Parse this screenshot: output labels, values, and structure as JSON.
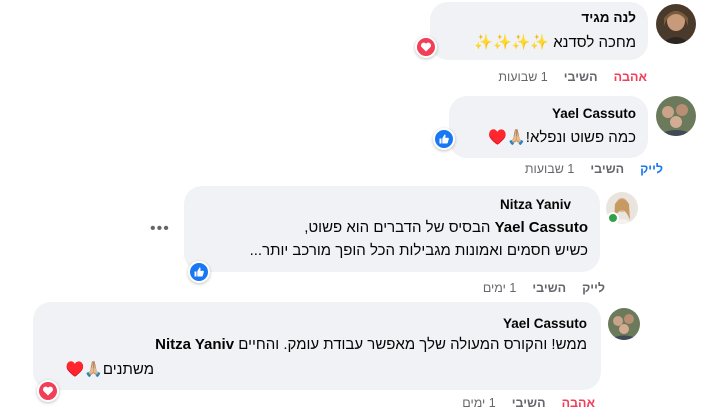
{
  "comments": [
    {
      "author": "לנה מגיד",
      "line1": "מחכה לסדנא ✨✨✨✨",
      "reaction_icon": "heart-reaction-icon",
      "actions": {
        "love": "אהבה",
        "reply": "השיבי",
        "time": "1 שבועות"
      }
    },
    {
      "author": "Yael Cassuto",
      "line1": "כמה פשוט ונפלא!🙏🏼♥️",
      "reaction_icon": "like-reaction-icon",
      "actions": {
        "like": "לייק",
        "reply": "השיבי",
        "time": "1 שבועות"
      }
    },
    {
      "author": "Nitza Yaniv",
      "mention": "Yael Cassuto",
      "line1_rest": " הבסיס של הדברים הוא פשוט,",
      "line2": "כשיש חסמים ואמונות מגבילות הכל הופך מורכב יותר...",
      "more_icon": "more-options-icon",
      "reaction_icon": "like-reaction-icon",
      "actions": {
        "like": "לייק",
        "reply": "השיבי",
        "time": "1 ימים"
      }
    },
    {
      "author": "Yael Cassuto",
      "line1_text": "ממש! והקורס המעולה שלך מאפשר עבודת עומק. והחיים ",
      "mention": "Nitza Yaniv",
      "line2": "משתנים🙏🏼♥️",
      "reaction_icon": "heart-reaction-icon",
      "actions": {
        "love": "אהבה",
        "reply": "השיבי",
        "time": "1 ימים"
      }
    }
  ],
  "colors": {
    "bubble": "#f0f2f5",
    "love": "#f33e58",
    "like": "#1877f2",
    "meta": "#65676b",
    "online": "#31a24c"
  }
}
